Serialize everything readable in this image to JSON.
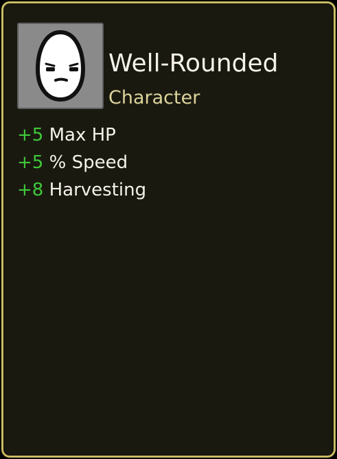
{
  "item": {
    "icon": "egg-character-icon",
    "title": "Well-Rounded",
    "type": "Character"
  },
  "stats": [
    {
      "value": "+5",
      "label": "Max HP"
    },
    {
      "value": "+5",
      "label": "% Speed"
    },
    {
      "value": "+8",
      "label": "Harvesting"
    }
  ],
  "colors": {
    "border": "#c9bc63",
    "background": "#1a1910",
    "positive": "#3ec93a",
    "type_text": "#dcd49b",
    "text": "#f4f2ea"
  }
}
